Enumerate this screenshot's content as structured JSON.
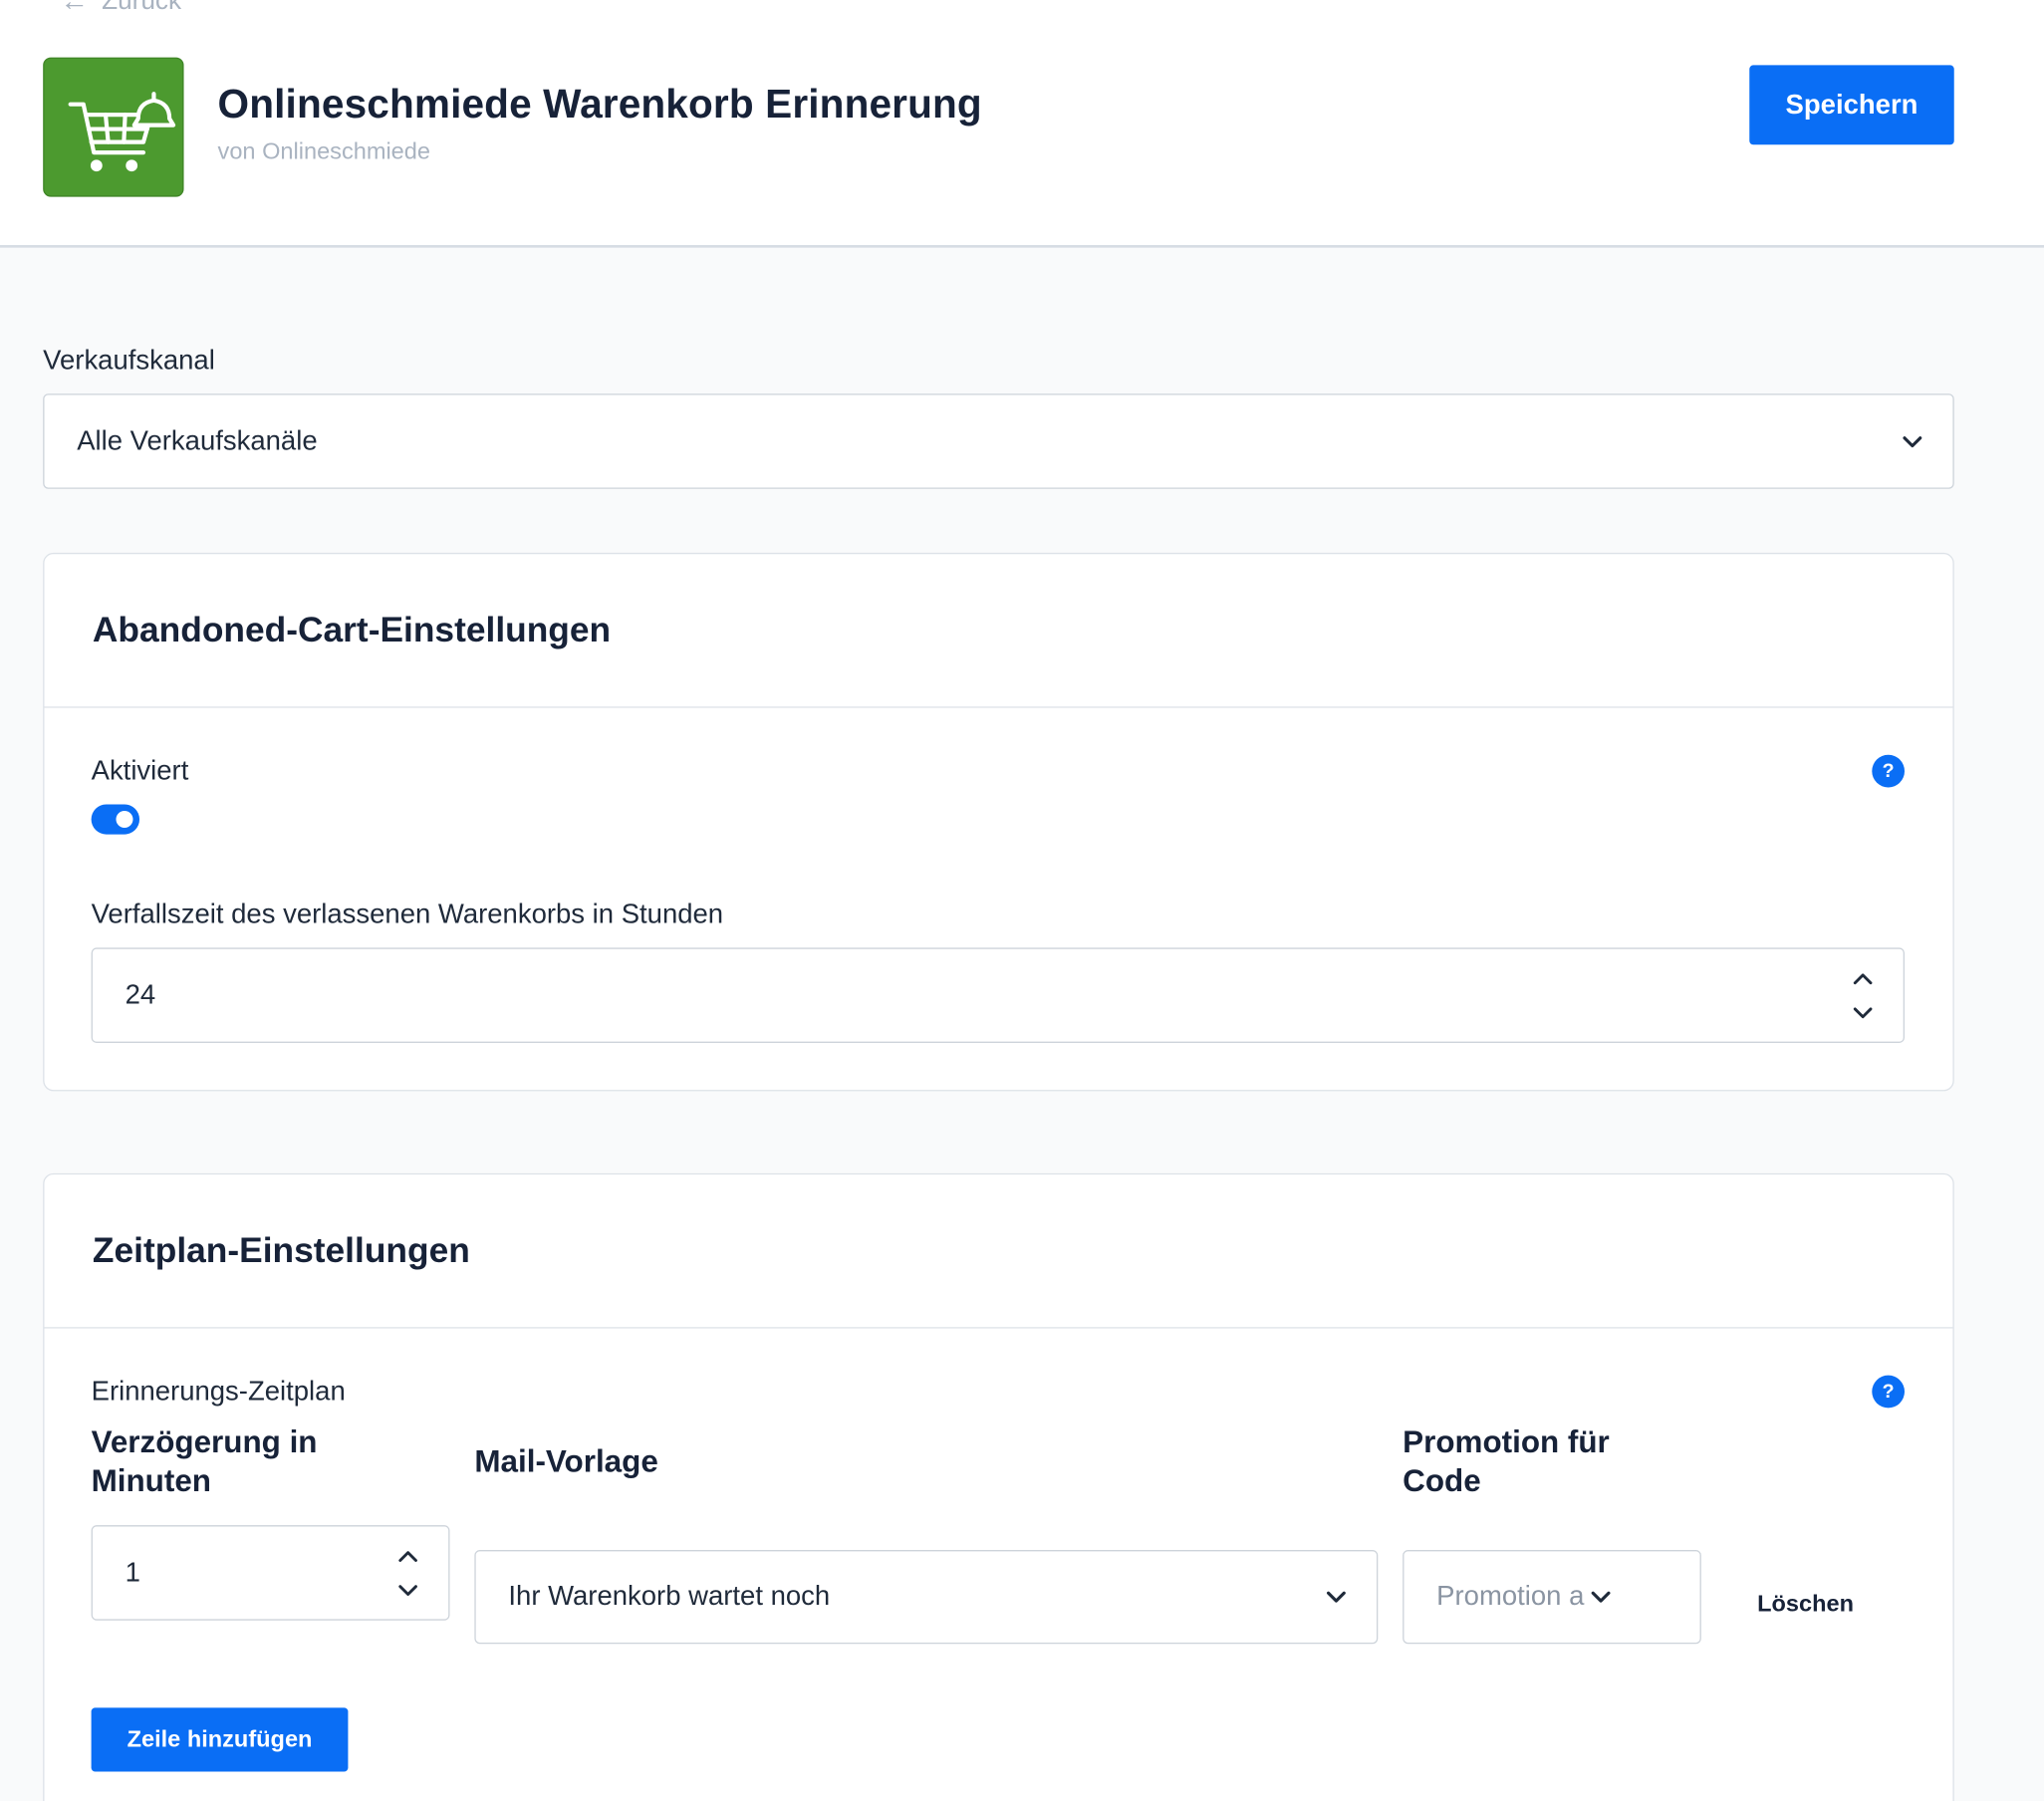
{
  "header": {
    "back_label": "Zurück",
    "app_title": "Onlineschmiede Warenkorb Erinnerung",
    "app_vendor": "von Onlineschmiede",
    "save_label": "Speichern",
    "logo_color": "#4c9a2f"
  },
  "sales_channel": {
    "label": "Verkaufskanal",
    "value": "Alle Verkaufskanäle"
  },
  "abandoned_cart": {
    "title": "Abandoned-Cart-Einstellungen",
    "enabled_label": "Aktiviert",
    "enabled": true,
    "help": "?",
    "expiry_label": "Verfallszeit des verlassenen Warenkorbs in Stunden",
    "expiry_value": "24"
  },
  "schedule": {
    "title": "Zeitplan-Einstellungen",
    "schedule_label": "Erinnerungs-Zeitplan",
    "help": "?",
    "col_delay": "Verzögerung in Minuten",
    "col_template": "Mail-Vorlage",
    "col_promotion": "Promotion für Code",
    "rows": [
      {
        "delay": "1",
        "template": "Ihr Warenkorb wartet noch",
        "promotion_placeholder": "Promotion a",
        "delete_label": "Löschen"
      }
    ],
    "add_row_label": "Zeile hinzufügen"
  },
  "colors": {
    "accent": "#0a6ef5",
    "text": "#172238",
    "muted": "#a9b3c0"
  }
}
